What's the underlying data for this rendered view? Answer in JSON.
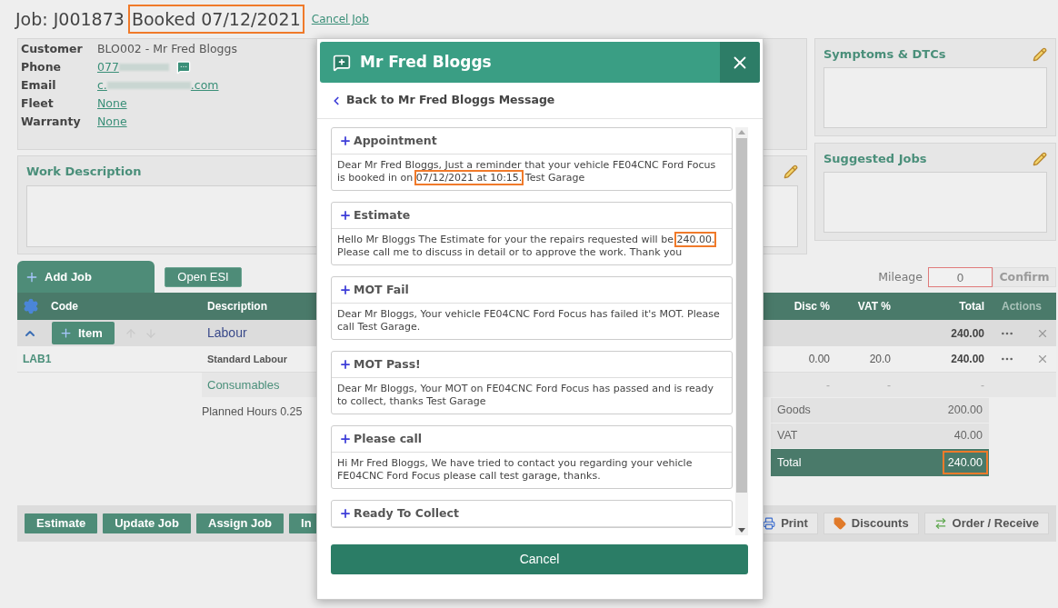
{
  "header": {
    "title": "Job: J001873",
    "status": "Booked 07/12/2021",
    "status_highlighted": true,
    "cancel_link": "Cancel Job"
  },
  "customer": {
    "fields": [
      {
        "label": "Customer",
        "value": "BLO002 - Mr Fred Bloggs",
        "kind": "text"
      },
      {
        "label": "Phone",
        "value": "077",
        "kind": "phone"
      },
      {
        "label": "Email",
        "value": "c.",
        "suffix": ".com",
        "kind": "email"
      },
      {
        "label": "Fleet",
        "value": "None",
        "kind": "link"
      },
      {
        "label": "Warranty",
        "value": "None",
        "kind": "link"
      }
    ]
  },
  "work_description": {
    "title": "Work Description"
  },
  "symptoms": {
    "title": "Symptoms & DTCs"
  },
  "suggested_jobs": {
    "title": "Suggested Jobs"
  },
  "job_tab": {
    "label": "Add Job"
  },
  "esi_button": "Open ESI",
  "mileage": {
    "label": "Mileage",
    "value": "0",
    "confirm": "Confirm",
    "confirm_disabled": true
  },
  "table": {
    "columns_left": [
      "Code",
      "Description"
    ],
    "columns_right": [
      "Disc %",
      "VAT %",
      "Total",
      "Actions"
    ],
    "group": {
      "expanded": true,
      "item_button": "Item",
      "name": "Labour",
      "total": "240.00"
    },
    "rows": [
      {
        "code": "LAB1",
        "description": "Standard Labour",
        "disc": "0.00",
        "vat": "20.0",
        "total": "240.00"
      }
    ],
    "consumables": {
      "name": "Consumables",
      "disc": "-",
      "vat": "-",
      "total": "-"
    },
    "planned_hours": "Planned Hours 0.25"
  },
  "totals": [
    {
      "label": "Goods",
      "value": "200.00",
      "kind": "line",
      "highlighted": false
    },
    {
      "label": "VAT",
      "value": "40.00",
      "kind": "line",
      "highlighted": false
    },
    {
      "label": "Total",
      "value": "240.00",
      "kind": "grand",
      "highlighted": true
    }
  ],
  "toolbar": {
    "left": [
      "Estimate",
      "Update Job",
      "Assign Job",
      "In"
    ],
    "right": [
      {
        "label": "Print",
        "kind": "print"
      },
      {
        "label": "Discounts",
        "kind": "tag"
      },
      {
        "label": "Order / Receive",
        "kind": "transfer"
      }
    ]
  },
  "dialog": {
    "title": "Mr Fred Bloggs",
    "back_link": "Back to Mr Fred Bloggs Message",
    "cancel": "Cancel",
    "templates": [
      {
        "title": "Appointment",
        "body": [
          {
            "text": "Dear Mr Fred Bloggs, Just a reminder that your vehicle FE04CNC Ford Focus is booked in on ",
            "highlighted": false
          },
          {
            "text": "07/12/2021 at 10:15.",
            "highlighted": true
          },
          {
            "text": " Test Garage",
            "highlighted": false
          }
        ]
      },
      {
        "title": "Estimate",
        "body": [
          {
            "text": "Hello Mr Bloggs The Estimate for your the repairs requested will be ",
            "highlighted": false
          },
          {
            "text": "240.00.",
            "highlighted": true
          },
          {
            "text": " Please call me to discuss in detail or to approve the work. Thank you",
            "highlighted": false
          }
        ]
      },
      {
        "title": "MOT Fail",
        "body": [
          {
            "text": "Dear Mr Bloggs, Your vehicle FE04CNC Ford Focus has failed it's MOT. Please call Test Garage.",
            "highlighted": false
          }
        ]
      },
      {
        "title": "MOT Pass!",
        "body": [
          {
            "text": "Dear Mr Bloggs, Your MOT on FE04CNC Ford Focus has passed and is ready to collect, thanks Test Garage",
            "highlighted": false
          }
        ]
      },
      {
        "title": "Please call",
        "body": [
          {
            "text": "Hi Mr Fred Bloggs, We have tried to contact you regarding your vehicle FE04CNC Ford Focus please call test garage, thanks.",
            "highlighted": false
          }
        ]
      },
      {
        "title": "Ready To Collect"
      }
    ]
  }
}
